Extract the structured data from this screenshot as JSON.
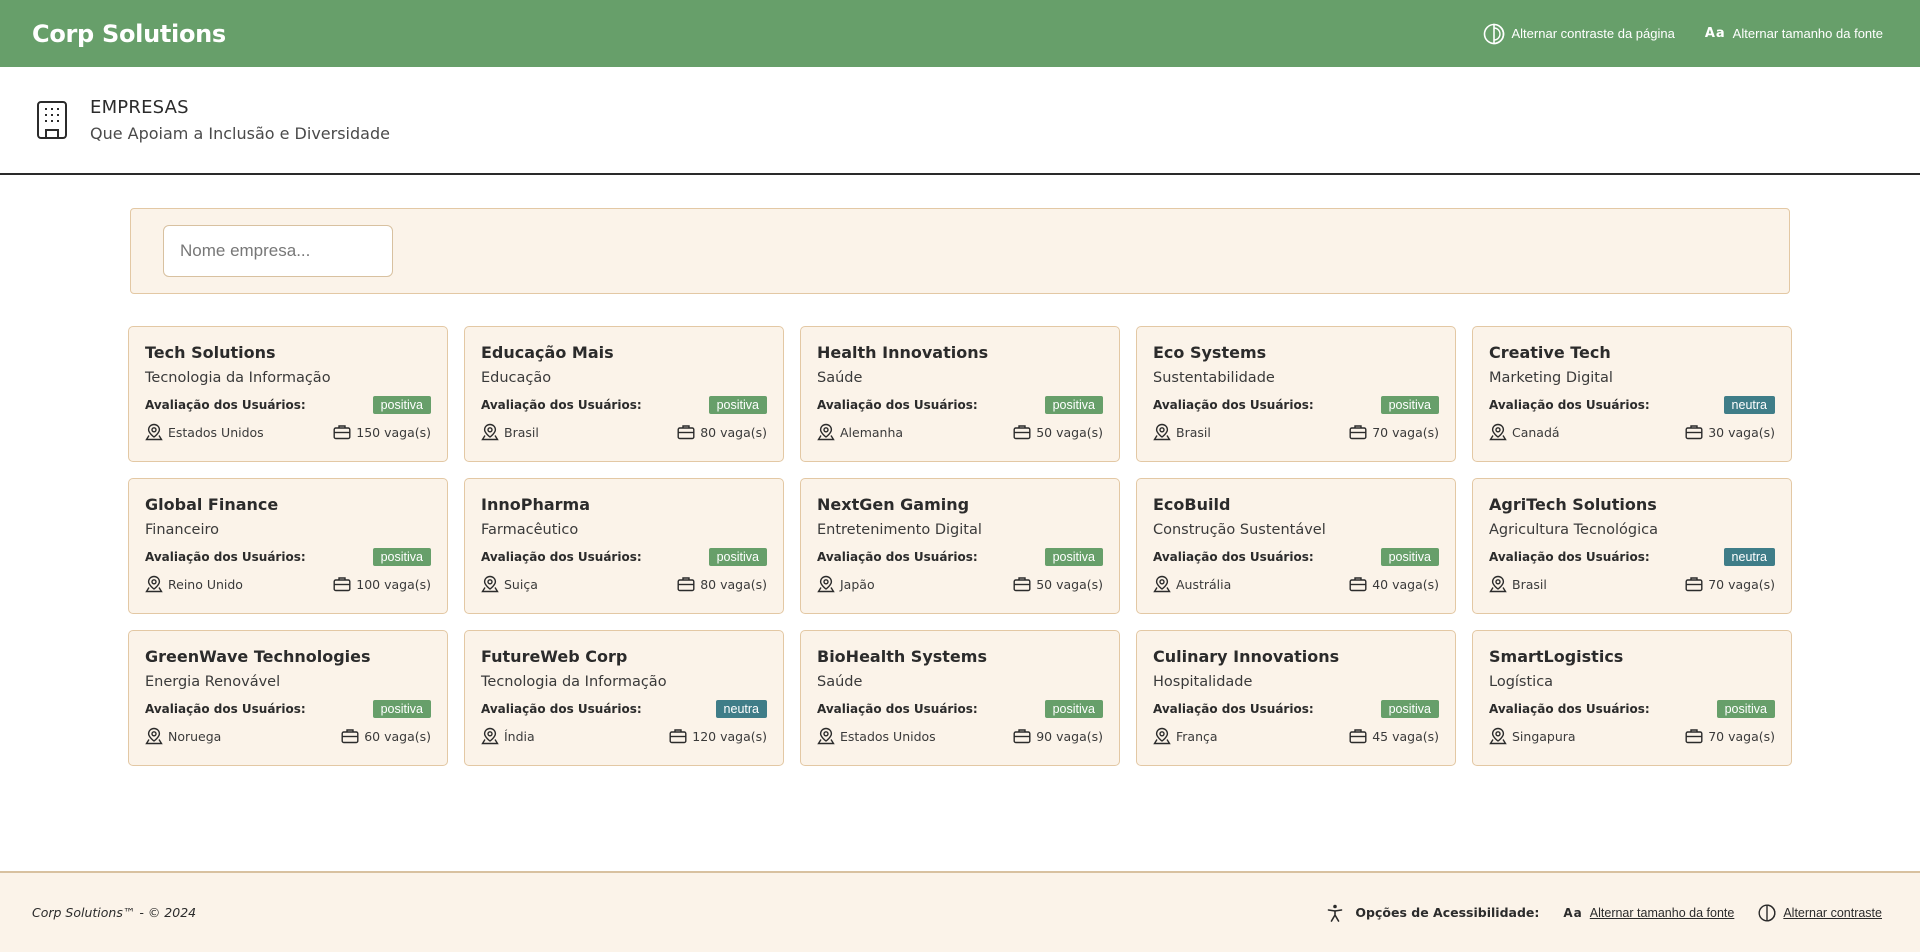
{
  "header": {
    "brand": "Corp Solutions",
    "contrast_label": "Alternar contraste da página",
    "font_label": "Alternar tamanho da fonte",
    "font_icon_text": "Aa"
  },
  "page": {
    "title": "EMPRESAS",
    "subtitle": "Que Apoiam a Inclusão e Diversidade"
  },
  "search": {
    "placeholder": "Nome empresa...",
    "value": ""
  },
  "rating_label": "Avaliação dos Usuários:",
  "companies": [
    {
      "name": "Tech Solutions",
      "sector": "Tecnologia da Informação",
      "rating": "positiva",
      "country": "Estados Unidos",
      "vacancies": "150 vaga(s)"
    },
    {
      "name": "Educação Mais",
      "sector": "Educação",
      "rating": "positiva",
      "country": "Brasil",
      "vacancies": "80 vaga(s)"
    },
    {
      "name": "Health Innovations",
      "sector": "Saúde",
      "rating": "positiva",
      "country": "Alemanha",
      "vacancies": "50 vaga(s)"
    },
    {
      "name": "Eco Systems",
      "sector": "Sustentabilidade",
      "rating": "positiva",
      "country": "Brasil",
      "vacancies": "70 vaga(s)"
    },
    {
      "name": "Creative Tech",
      "sector": "Marketing Digital",
      "rating": "neutra",
      "country": "Canadá",
      "vacancies": "30 vaga(s)"
    },
    {
      "name": "Global Finance",
      "sector": "Financeiro",
      "rating": "positiva",
      "country": "Reino Unido",
      "vacancies": "100 vaga(s)"
    },
    {
      "name": "InnoPharma",
      "sector": "Farmacêutico",
      "rating": "positiva",
      "country": "Suiça",
      "vacancies": "80 vaga(s)"
    },
    {
      "name": "NextGen Gaming",
      "sector": "Entretenimento Digital",
      "rating": "positiva",
      "country": "Japão",
      "vacancies": "50 vaga(s)"
    },
    {
      "name": "EcoBuild",
      "sector": "Construção Sustentável",
      "rating": "positiva",
      "country": "Austrália",
      "vacancies": "40 vaga(s)"
    },
    {
      "name": "AgriTech Solutions",
      "sector": "Agricultura Tecnológica",
      "rating": "neutra",
      "country": "Brasil",
      "vacancies": "70 vaga(s)"
    },
    {
      "name": "GreenWave Technologies",
      "sector": "Energia Renovável",
      "rating": "positiva",
      "country": "Noruega",
      "vacancies": "60 vaga(s)"
    },
    {
      "name": "FutureWeb Corp",
      "sector": "Tecnologia da Informação",
      "rating": "neutra",
      "country": "Índia",
      "vacancies": "120 vaga(s)"
    },
    {
      "name": "BioHealth Systems",
      "sector": "Saúde",
      "rating": "positiva",
      "country": "Estados Unidos",
      "vacancies": "90 vaga(s)"
    },
    {
      "name": "Culinary Innovations",
      "sector": "Hospitalidade",
      "rating": "positiva",
      "country": "França",
      "vacancies": "45 vaga(s)"
    },
    {
      "name": "SmartLogistics",
      "sector": "Logística",
      "rating": "positiva",
      "country": "Singapura",
      "vacancies": "70 vaga(s)"
    }
  ],
  "footer": {
    "copyright": "Corp Solutions™ - © 2024",
    "a11y_label": "Opções de Acessibilidade:",
    "font_link": "Alternar tamanho da fonte",
    "contrast_link": "Alternar contraste",
    "font_icon_text": "Aa"
  },
  "colors": {
    "brand_green": "#679f6a",
    "badge_positiva": "#679f6a",
    "badge_neutra": "#3f7d88",
    "card_bg": "#fbf3e9",
    "card_border": "#e3c8a4"
  },
  "icons": {
    "contrast": "contrast-icon",
    "font_size": "font-size-icon",
    "building": "building-icon",
    "location": "location-pin-icon",
    "briefcase": "briefcase-icon",
    "accessibility": "accessibility-icon"
  }
}
